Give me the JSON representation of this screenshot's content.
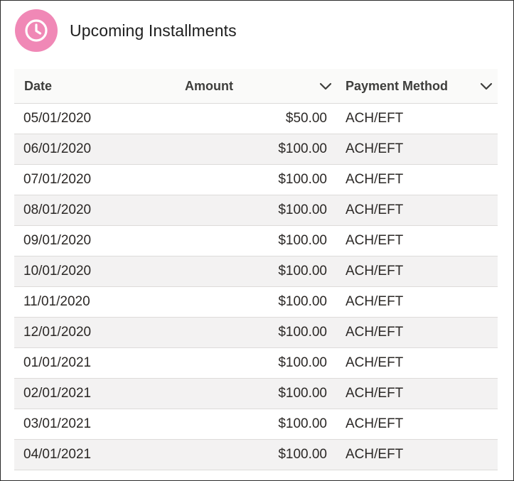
{
  "header": {
    "title": "Upcoming Installments",
    "icon": "clock-icon",
    "icon_color": "#f088b6"
  },
  "table": {
    "columns": [
      {
        "label": "Date",
        "sortable": false
      },
      {
        "label": "Amount",
        "sortable": true
      },
      {
        "label": "Payment Method",
        "sortable": true
      }
    ],
    "rows": [
      {
        "date": "05/01/2020",
        "amount": "$50.00",
        "method": "ACH/EFT"
      },
      {
        "date": "06/01/2020",
        "amount": "$100.00",
        "method": "ACH/EFT"
      },
      {
        "date": "07/01/2020",
        "amount": "$100.00",
        "method": "ACH/EFT"
      },
      {
        "date": "08/01/2020",
        "amount": "$100.00",
        "method": "ACH/EFT"
      },
      {
        "date": "09/01/2020",
        "amount": "$100.00",
        "method": "ACH/EFT"
      },
      {
        "date": "10/01/2020",
        "amount": "$100.00",
        "method": "ACH/EFT"
      },
      {
        "date": "11/01/2020",
        "amount": "$100.00",
        "method": "ACH/EFT"
      },
      {
        "date": "12/01/2020",
        "amount": "$100.00",
        "method": "ACH/EFT"
      },
      {
        "date": "01/01/2021",
        "amount": "$100.00",
        "method": "ACH/EFT"
      },
      {
        "date": "02/01/2021",
        "amount": "$100.00",
        "method": "ACH/EFT"
      },
      {
        "date": "03/01/2021",
        "amount": "$100.00",
        "method": "ACH/EFT"
      },
      {
        "date": "04/01/2021",
        "amount": "$100.00",
        "method": "ACH/EFT"
      }
    ]
  }
}
